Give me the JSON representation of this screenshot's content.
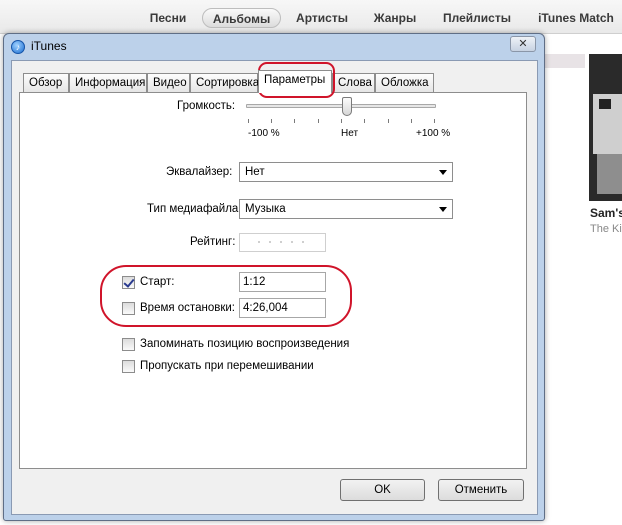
{
  "top_nav": {
    "items": [
      {
        "label": "Песни",
        "active": false
      },
      {
        "label": "Альбомы",
        "active": true
      },
      {
        "label": "Артисты",
        "active": false
      },
      {
        "label": "Жанры",
        "active": false
      },
      {
        "label": "Плейлисты",
        "active": false
      },
      {
        "label": "iTunes Match",
        "active": false
      }
    ]
  },
  "album": {
    "title": "Sam's",
    "artist": "The Ki"
  },
  "dialog": {
    "title": "iTunes",
    "close_icon": "close-icon",
    "tabs": [
      {
        "label": "Обзор"
      },
      {
        "label": "Информация"
      },
      {
        "label": "Видео"
      },
      {
        "label": "Сортировка"
      },
      {
        "label": "Параметры"
      },
      {
        "label": "Слова"
      },
      {
        "label": "Обложка"
      }
    ],
    "active_tab": "Параметры",
    "volume": {
      "label": "Громкость:",
      "min_label": "-100 %",
      "mid_label": "Нет",
      "max_label": "+100 %",
      "value_fraction": 0.53
    },
    "equalizer": {
      "label": "Эквалайзер:",
      "value": "Нет"
    },
    "media_type": {
      "label": "Тип медиафайла:",
      "value": "Музыка"
    },
    "rating": {
      "label": "Рейтинг:",
      "stars": 0,
      "max": 5
    },
    "start": {
      "label": "Старт:",
      "checked": true,
      "value": "1:12"
    },
    "stop": {
      "label": "Время остановки:",
      "checked": false,
      "value": "4:26,004"
    },
    "remember_position": {
      "label": "Запоминать позицию воспроизведения",
      "checked": false
    },
    "skip_shuffle": {
      "label": "Пропускать при перемешивании",
      "checked": false
    },
    "ok_label": "OK",
    "cancel_label": "Отменить"
  },
  "colors": {
    "annotation": "#d0142a",
    "dialog_frame": "#bcd1ea"
  }
}
